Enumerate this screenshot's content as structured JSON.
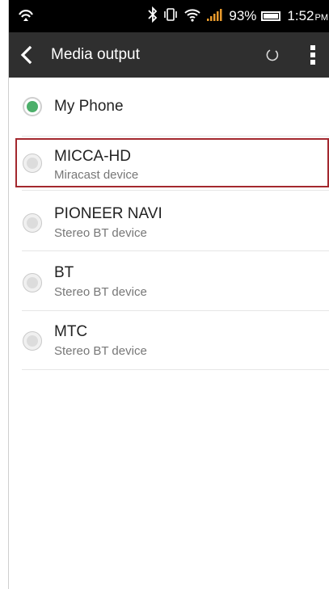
{
  "status_bar": {
    "battery_percent": "93%",
    "time": "1:52",
    "ampm": "PM",
    "icons": [
      "sync-icon",
      "bluetooth-icon",
      "vibrate-icon",
      "wifi-icon",
      "signal-icon",
      "battery-icon"
    ]
  },
  "action_bar": {
    "title": "Media output",
    "icons": [
      "back-icon",
      "loading-spinner-icon",
      "overflow-menu-icon"
    ]
  },
  "devices": [
    {
      "name": "My Phone",
      "subtitle": "",
      "selected": true
    },
    {
      "name": "MICCA-HD",
      "subtitle": "Miracast device",
      "selected": false,
      "highlighted": true
    },
    {
      "name": "PIONEER NAVI",
      "subtitle": "Stereo BT device",
      "selected": false
    },
    {
      "name": "BT",
      "subtitle": "Stereo BT device",
      "selected": false
    },
    {
      "name": "MTC",
      "subtitle": "Stereo BT device",
      "selected": false
    }
  ],
  "colors": {
    "selected_radio": "#4caf6a",
    "highlight_border": "#a3282e",
    "action_bar": "#2f2f2f"
  }
}
